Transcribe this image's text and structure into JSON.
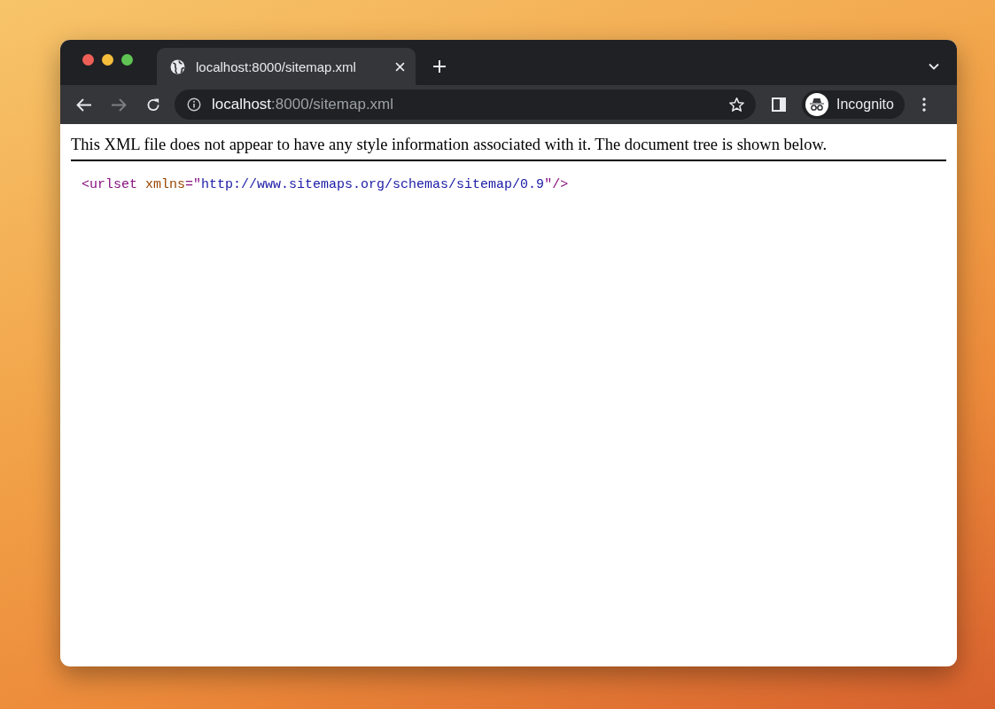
{
  "tabs": [
    {
      "title": "localhost:8000/sitemap.xml",
      "selected": true
    }
  ],
  "address_bar": {
    "host": "localhost",
    "path": ":8000/sitemap.xml"
  },
  "profile": {
    "label": "Incognito"
  },
  "page": {
    "notice": "This XML file does not appear to have any style information associated with it. The document tree is shown below.",
    "xml_tokens": [
      {
        "kind": "tag",
        "text": "<urlset"
      },
      {
        "kind": "attribute",
        "text": "xmlns"
      },
      {
        "kind": "punctuation",
        "text": "=\""
      },
      {
        "kind": "value",
        "text": "http://www.sitemaps.org/schemas/sitemap/0.9"
      },
      {
        "kind": "punctuation",
        "text": "\"/>"
      }
    ]
  }
}
